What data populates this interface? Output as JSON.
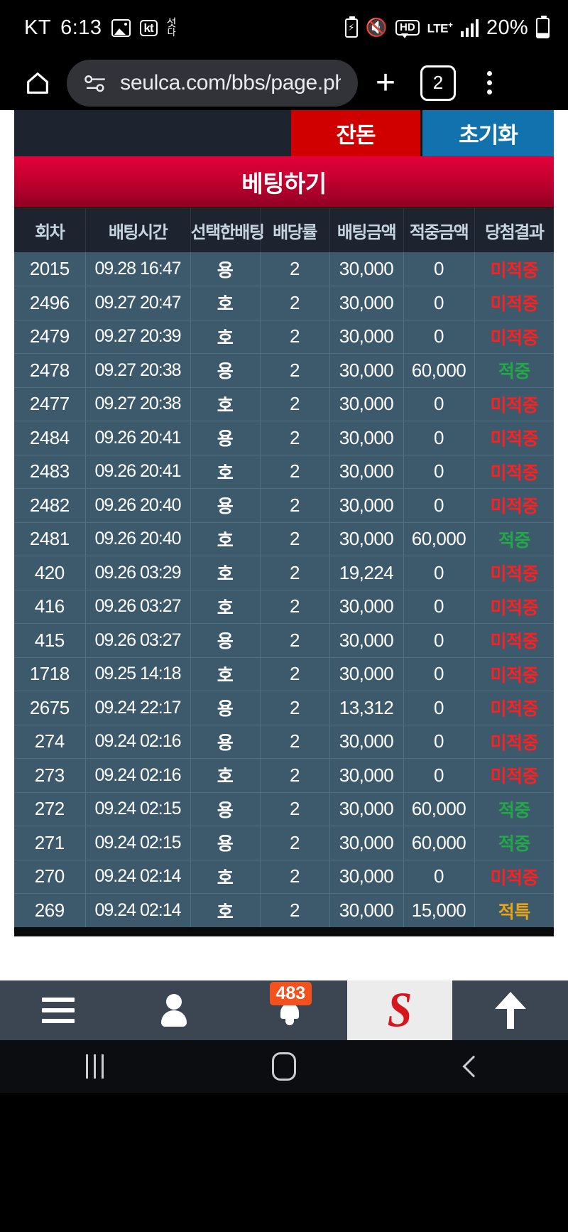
{
  "status_bar": {
    "carrier": "KT",
    "time": "6:13",
    "photo_icon": "photo-icon",
    "kt_icon": "kt-badge-icon",
    "hangul_icon_top": "섯",
    "hangul_icon_bottom": "다",
    "battery_saver_icon": "battery-saver-icon",
    "mute_icon": "mute-icon",
    "hd_icon": "HD",
    "network": "LTE",
    "network_sup": "+",
    "signal_icon": "signal-bars-icon",
    "battery_percent": "20%"
  },
  "browser": {
    "home_icon": "home-icon",
    "site_settings_icon": "site-settings-icon",
    "url": "seulca.com/bbs/page.ph",
    "new_tab_icon": "plus-icon",
    "tab_count": "2",
    "menu_icon": "more-vertical-icon"
  },
  "toolbar": {
    "balance_label": "잔돈",
    "reset_label": "초기화",
    "balance_color": "#d10000",
    "reset_color": "#1272ad"
  },
  "betting_panel": {
    "title": "베팅하기",
    "title_color": "#c3002f"
  },
  "table": {
    "columns": [
      "회차",
      "배팅시간",
      "선택한배팅",
      "배당률",
      "배팅금액",
      "적중금액",
      "당첨결과"
    ],
    "result_colors": {
      "미적중": "#ff1f1f",
      "적중": "#23a848",
      "적특": "#e8a417"
    },
    "rows": [
      {
        "round": "2015",
        "time": "09.28 16:47",
        "pick": "용",
        "odds": "2",
        "bet": "30,000",
        "win": "0",
        "result": "미적중"
      },
      {
        "round": "2496",
        "time": "09.27 20:47",
        "pick": "호",
        "odds": "2",
        "bet": "30,000",
        "win": "0",
        "result": "미적중"
      },
      {
        "round": "2479",
        "time": "09.27 20:39",
        "pick": "호",
        "odds": "2",
        "bet": "30,000",
        "win": "0",
        "result": "미적중"
      },
      {
        "round": "2478",
        "time": "09.27 20:38",
        "pick": "용",
        "odds": "2",
        "bet": "30,000",
        "win": "60,000",
        "result": "적중"
      },
      {
        "round": "2477",
        "time": "09.27 20:38",
        "pick": "호",
        "odds": "2",
        "bet": "30,000",
        "win": "0",
        "result": "미적중"
      },
      {
        "round": "2484",
        "time": "09.26 20:41",
        "pick": "용",
        "odds": "2",
        "bet": "30,000",
        "win": "0",
        "result": "미적중"
      },
      {
        "round": "2483",
        "time": "09.26 20:41",
        "pick": "호",
        "odds": "2",
        "bet": "30,000",
        "win": "0",
        "result": "미적중"
      },
      {
        "round": "2482",
        "time": "09.26 20:40",
        "pick": "용",
        "odds": "2",
        "bet": "30,000",
        "win": "0",
        "result": "미적중"
      },
      {
        "round": "2481",
        "time": "09.26 20:40",
        "pick": "호",
        "odds": "2",
        "bet": "30,000",
        "win": "60,000",
        "result": "적중"
      },
      {
        "round": "420",
        "time": "09.26 03:29",
        "pick": "호",
        "odds": "2",
        "bet": "19,224",
        "win": "0",
        "result": "미적중"
      },
      {
        "round": "416",
        "time": "09.26 03:27",
        "pick": "호",
        "odds": "2",
        "bet": "30,000",
        "win": "0",
        "result": "미적중"
      },
      {
        "round": "415",
        "time": "09.26 03:27",
        "pick": "용",
        "odds": "2",
        "bet": "30,000",
        "win": "0",
        "result": "미적중"
      },
      {
        "round": "1718",
        "time": "09.25 14:18",
        "pick": "호",
        "odds": "2",
        "bet": "30,000",
        "win": "0",
        "result": "미적중"
      },
      {
        "round": "2675",
        "time": "09.24 22:17",
        "pick": "용",
        "odds": "2",
        "bet": "13,312",
        "win": "0",
        "result": "미적중"
      },
      {
        "round": "274",
        "time": "09.24 02:16",
        "pick": "용",
        "odds": "2",
        "bet": "30,000",
        "win": "0",
        "result": "미적중"
      },
      {
        "round": "273",
        "time": "09.24 02:16",
        "pick": "호",
        "odds": "2",
        "bet": "30,000",
        "win": "0",
        "result": "미적중"
      },
      {
        "round": "272",
        "time": "09.24 02:15",
        "pick": "용",
        "odds": "2",
        "bet": "30,000",
        "win": "60,000",
        "result": "적중"
      },
      {
        "round": "271",
        "time": "09.24 02:15",
        "pick": "용",
        "odds": "2",
        "bet": "30,000",
        "win": "60,000",
        "result": "적중"
      },
      {
        "round": "270",
        "time": "09.24 02:14",
        "pick": "호",
        "odds": "2",
        "bet": "30,000",
        "win": "0",
        "result": "미적중"
      },
      {
        "round": "269",
        "time": "09.24 02:14",
        "pick": "호",
        "odds": "2",
        "bet": "30,000",
        "win": "15,000",
        "result": "적특"
      }
    ]
  },
  "app_nav": {
    "menu_icon": "hamburger-menu-icon",
    "profile_icon": "person-icon",
    "notifications_icon": "bell-icon",
    "notification_count": "483",
    "logo_text": "S",
    "scroll_top_icon": "arrow-up-icon"
  },
  "android_nav": {
    "recents_icon": "recents-icon",
    "home_icon": "home-circle-icon",
    "back_icon": "back-chevron-icon"
  }
}
